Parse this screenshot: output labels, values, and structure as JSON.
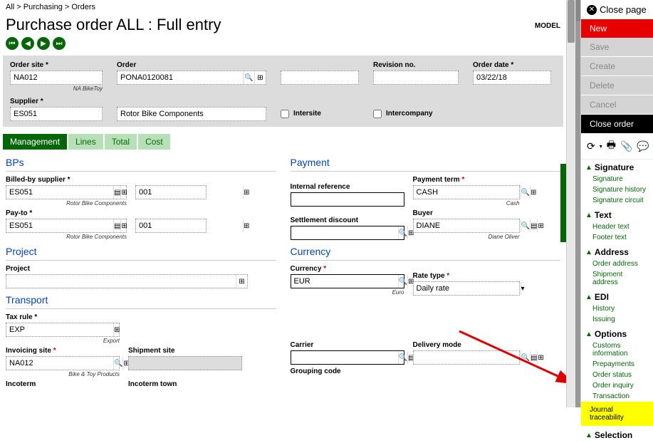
{
  "breadcrumb": {
    "all": "All",
    "purchasing": "Purchasing",
    "orders": "Orders"
  },
  "page_title": "Purchase order ALL : Full entry",
  "model_label": "MODEL",
  "header": {
    "order_site_label": "Order site",
    "order_site_value": "NA012",
    "order_site_hint": "NA BikeToy",
    "order_label": "Order",
    "order_value": "PONA0120081",
    "revision_label": "Revision no.",
    "revision_value": "",
    "order_date_label": "Order date",
    "order_date_value": "03/22/18",
    "supplier_label": "Supplier",
    "supplier_value": "ES051",
    "supplier_name": "Rotor Bike Components",
    "intersite_label": "Intersite",
    "intercompany_label": "Intercompany"
  },
  "tabs": {
    "management": "Management",
    "lines": "Lines",
    "total": "Total",
    "cost": "Cost"
  },
  "bps": {
    "title": "BPs",
    "billed_by_label": "Billed-by supplier",
    "billed_by_value": "ES051",
    "billed_by_code": "001",
    "billed_by_hint": "Rotor Bike Components",
    "pay_to_label": "Pay-to",
    "pay_to_value": "ES051",
    "pay_to_code": "001",
    "pay_to_hint": "Rotor Bike Components"
  },
  "project": {
    "title": "Project",
    "label": "Project",
    "value": ""
  },
  "transport": {
    "title": "Transport",
    "tax_rule_label": "Tax rule",
    "tax_rule_value": "EXP",
    "tax_rule_hint": "Export",
    "invoicing_site_label": "Invoicing site",
    "invoicing_site_value": "NA012",
    "invoicing_site_hint": "Bike & Toy Products",
    "shipment_site_label": "Shipment site",
    "carrier_label": "Carrier",
    "delivery_mode_label": "Delivery mode",
    "incoterm_label": "Incoterm",
    "incoterm_town_label": "Incoterm town",
    "grouping_code_label": "Grouping code"
  },
  "payment": {
    "title": "Payment",
    "internal_ref_label": "Internal reference",
    "payment_term_label": "Payment term",
    "payment_term_value": "CASH",
    "payment_term_hint": "Cash",
    "settlement_label": "Settlement discount",
    "buyer_label": "Buyer",
    "buyer_value": "DIANE",
    "buyer_hint": "Diane Oliver"
  },
  "currency": {
    "title": "Currency",
    "currency_label": "Currency",
    "currency_value": "EUR",
    "currency_hint": "Euro",
    "rate_type_label": "Rate type",
    "rate_type_value": "Daily rate"
  },
  "right": {
    "close_page": "Close page",
    "new": "New",
    "save": "Save",
    "create": "Create",
    "delete": "Delete",
    "cancel": "Cancel",
    "close_order": "Close order",
    "signature": "Signature",
    "signature_sub": "Signature",
    "signature_history": "Signature history",
    "signature_circuit": "Signature circuit",
    "text": "Text",
    "header_text": "Header text",
    "footer_text": "Footer text",
    "address": "Address",
    "order_address": "Order address",
    "shipment_address": "Shipment address",
    "edi": "EDI",
    "history": "History",
    "issuing": "Issuing",
    "options": "Options",
    "customs_info": "Customs information",
    "prepayments": "Prepayments",
    "order_status": "Order status",
    "order_inquiry": "Order inquiry",
    "transaction": "Transaction",
    "journal_traceability": "Journal traceability",
    "selection": "Selection"
  }
}
